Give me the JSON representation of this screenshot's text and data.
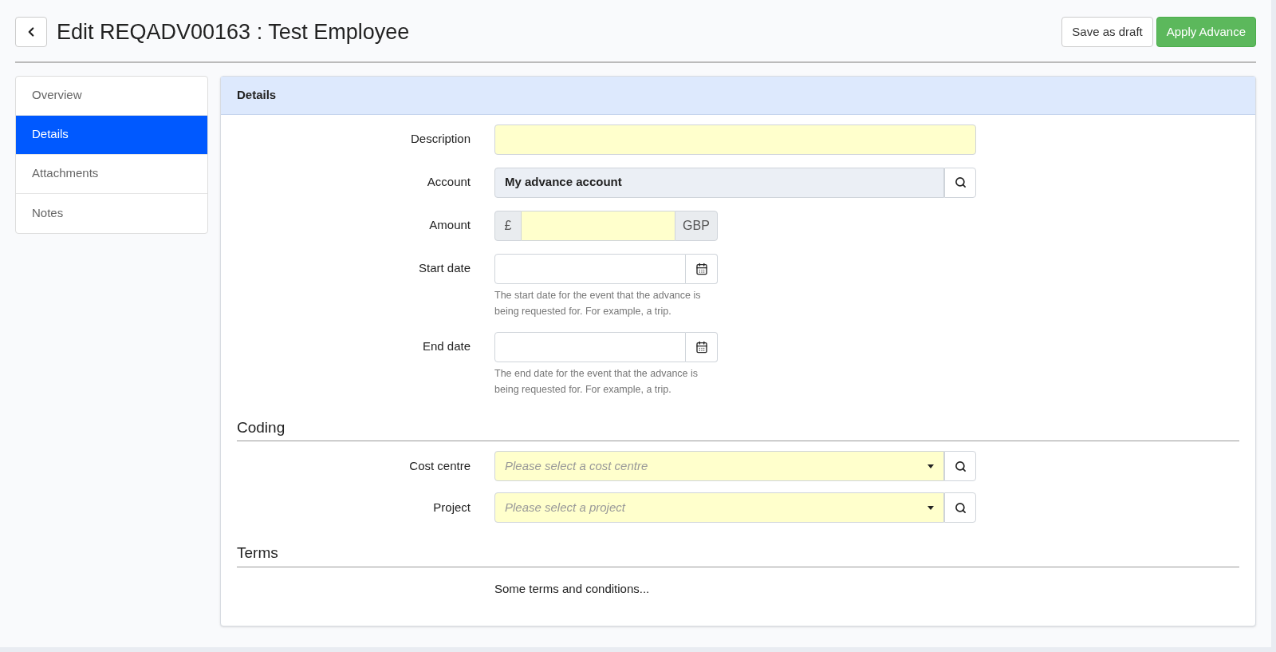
{
  "header": {
    "title": "Edit REQADV00163 : Test Employee",
    "buttons": [
      {
        "label": "Save as draft",
        "kind": "default"
      },
      {
        "label": "Apply Advance",
        "kind": "primary"
      }
    ]
  },
  "sidebar": {
    "items": [
      {
        "label": "Overview",
        "selected": false
      },
      {
        "label": "Details",
        "selected": true
      },
      {
        "label": "Attachments",
        "selected": false
      },
      {
        "label": "Notes",
        "selected": false
      }
    ]
  },
  "panel": {
    "title": "Details",
    "fields": [
      {
        "kind": "text",
        "label": "Description",
        "required": true
      },
      {
        "kind": "lookup",
        "label": "Account",
        "value": "My advance account",
        "readonly": true
      },
      {
        "kind": "currency",
        "label": "Amount",
        "prefix": "£",
        "suffix": "GBP",
        "required": true
      },
      {
        "kind": "date",
        "label": "Start date",
        "required": false,
        "help": "The start date for the event that the advance is being requested for. For example, a trip."
      },
      {
        "kind": "date",
        "label": "End date",
        "required": false,
        "help": "The end date for the event that the advance is being requested for. For example, a trip."
      }
    ],
    "sections": [
      {
        "kind": "fields",
        "title": "Coding",
        "fields": [
          {
            "kind": "select",
            "label": "Cost centre",
            "placeholder": "Please select a cost centre",
            "required": true
          },
          {
            "kind": "select",
            "label": "Project",
            "placeholder": "Please select a project",
            "required": true
          }
        ]
      },
      {
        "kind": "text",
        "title": "Terms",
        "text": "Some terms and conditions..."
      }
    ]
  }
}
